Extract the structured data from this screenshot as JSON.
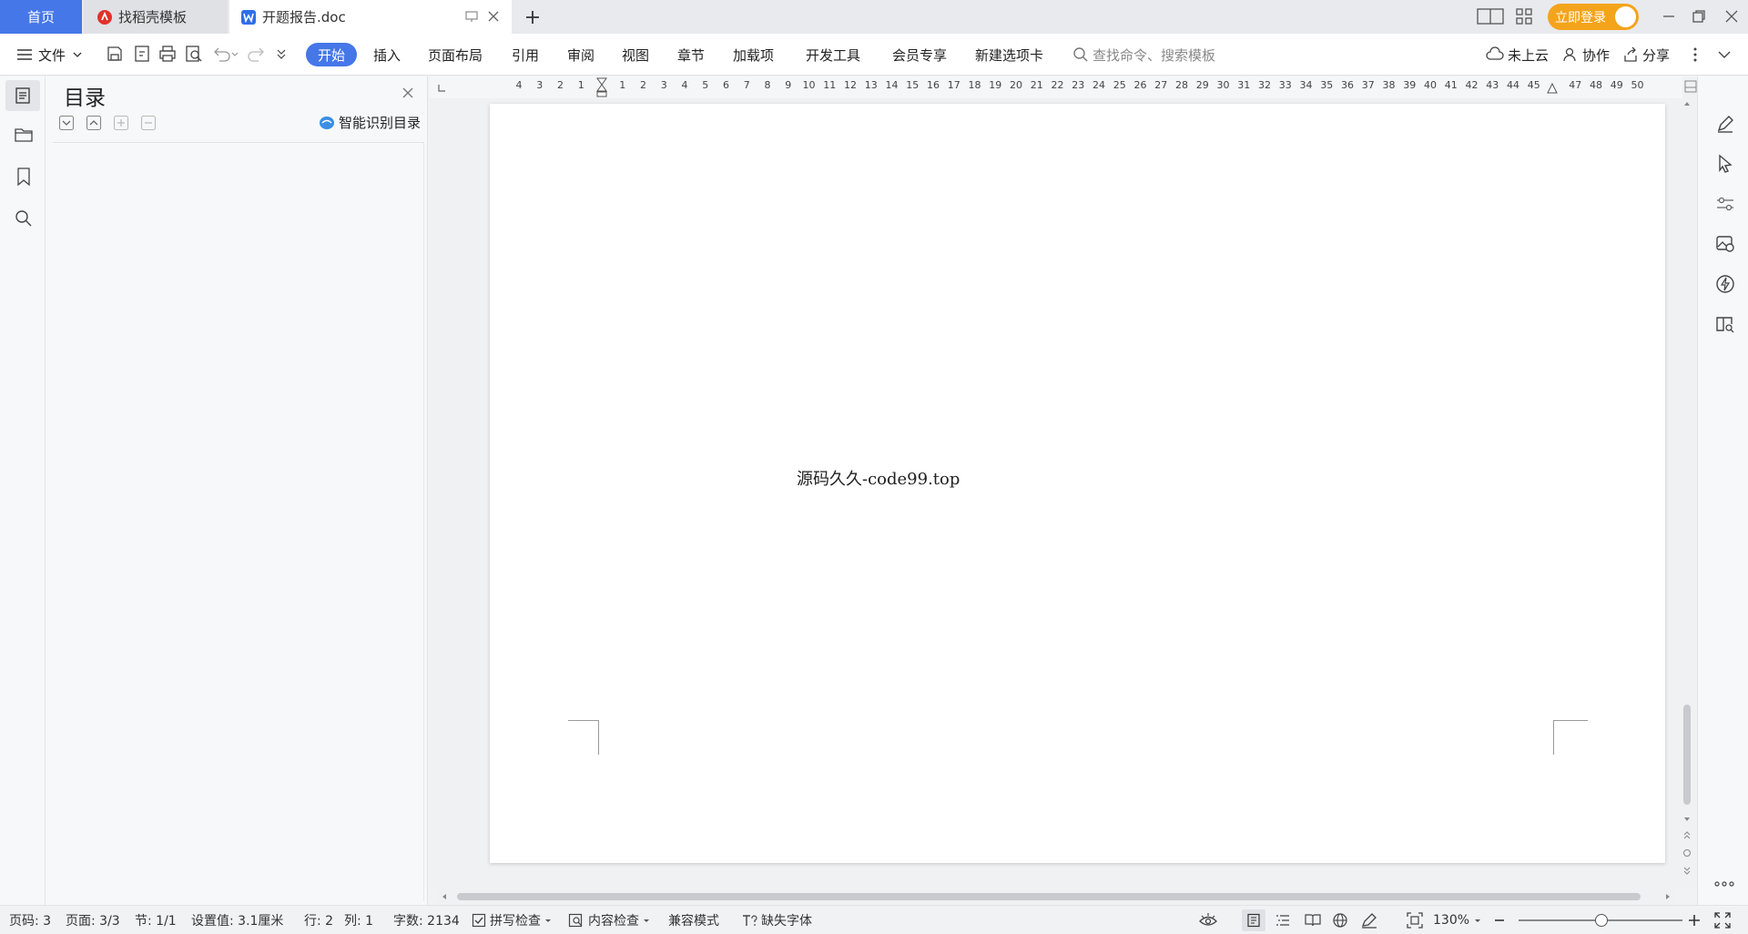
{
  "tabs": {
    "home": "首页",
    "template": "找稻壳模板",
    "document": "开题报告.doc"
  },
  "account": {
    "login_label": "立即登录"
  },
  "toolbar": {
    "file_label": "文件",
    "menus": [
      "开始",
      "插入",
      "页面布局",
      "引用",
      "审阅",
      "视图",
      "章节",
      "加载项",
      "开发工具",
      "会员专享",
      "新建选项卡"
    ],
    "search_placeholder": "查找命令、搜索模板",
    "cloud_label": "未上云",
    "collab_label": "协作",
    "share_label": "分享"
  },
  "toc_panel": {
    "title": "目录",
    "smart_label": "智能识别目录"
  },
  "ruler": {
    "left_numbers": [
      4,
      3,
      2,
      1
    ],
    "right_numbers": [
      1,
      2,
      3,
      4,
      5,
      6,
      7,
      8,
      9,
      10,
      11,
      12,
      13,
      14,
      15,
      16,
      17,
      18,
      19,
      20,
      21,
      22,
      23,
      24,
      25,
      26,
      27,
      28,
      29,
      30,
      31,
      32,
      33,
      34,
      35,
      36,
      37,
      38,
      39,
      40,
      41,
      42,
      43,
      44,
      45,
      47,
      48,
      49,
      50
    ]
  },
  "document": {
    "watermark_text": "源码久久-code99.top"
  },
  "status": {
    "page_code": "页码: 3",
    "pages": "页面: 3/3",
    "section": "节: 1/1",
    "setting": "设置值: 3.1厘米",
    "row": "行: 2",
    "col": "列: 1",
    "word_count": "字数: 2134",
    "spell_check": "拼写检查",
    "content_check": "内容检查",
    "compat_mode": "兼容模式",
    "missing_fonts": "缺失字体",
    "zoom": "130%"
  },
  "colors": {
    "accent": "#4577e8",
    "login": "#f4a41b"
  }
}
